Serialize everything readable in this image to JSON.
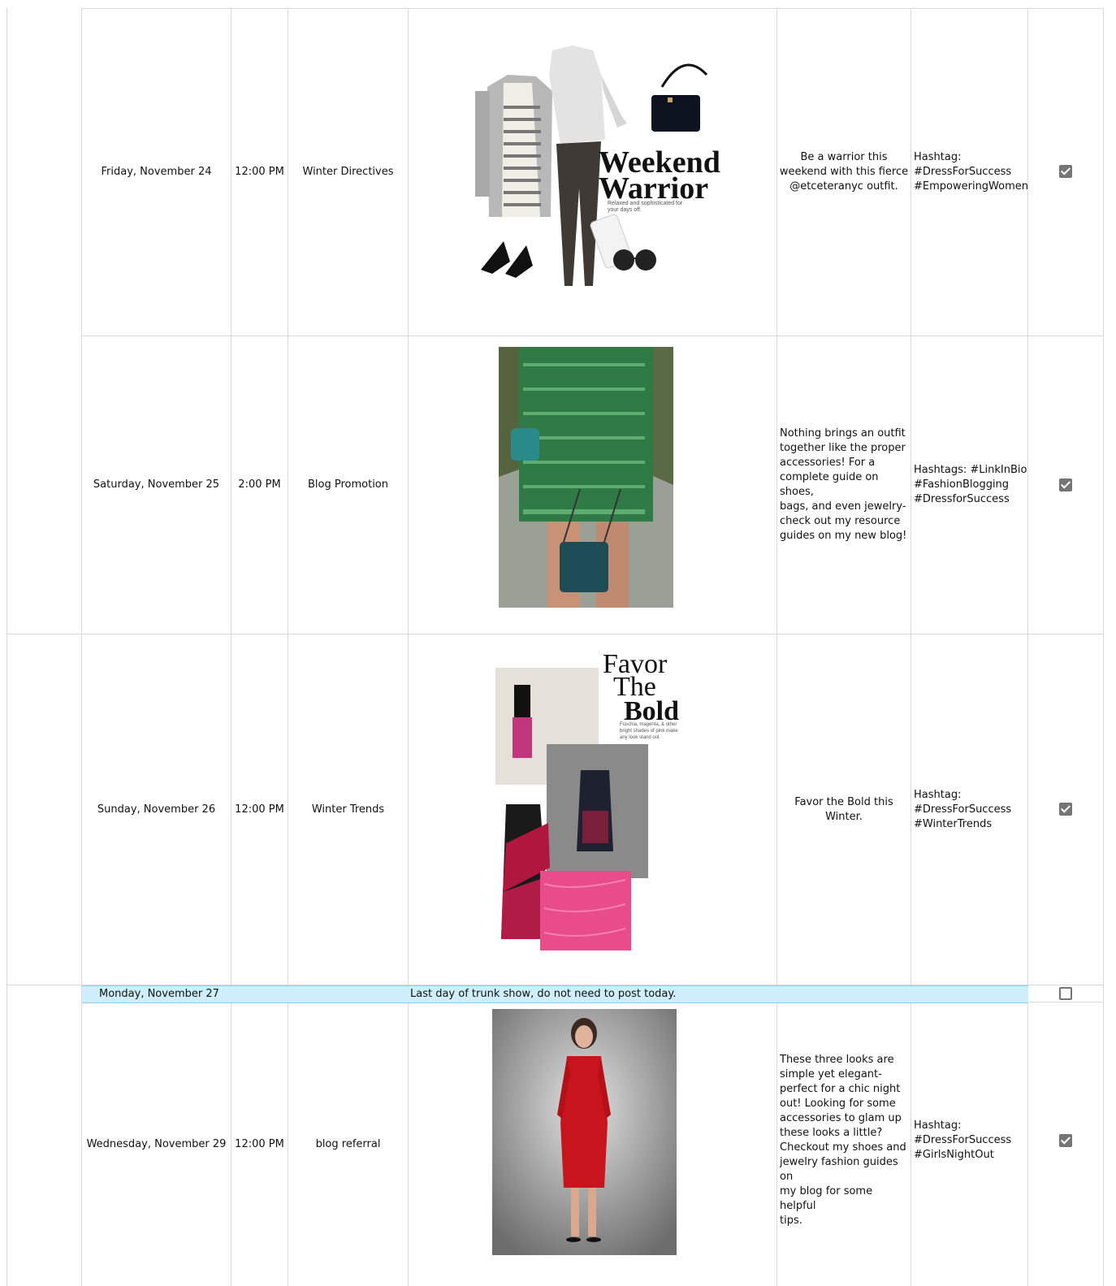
{
  "rows": [
    {
      "date": "Friday, November 24",
      "time": "12:00 PM",
      "topic": "Winter Directives",
      "image": "weekend-warrior-collage",
      "image_title": "Weekend\nWarrior",
      "image_subtitle": "Relaxed and sophisticated for\nyour days off.",
      "caption": "Be a warrior this\nweekend with this fierce\n@etceteranyc outfit.",
      "hashtags": "Hashtag:\n#DressForSuccess\n#EmpoweringWomen",
      "done": true
    },
    {
      "date": "Saturday, November 25",
      "time": "2:00 PM",
      "topic": "Blog Promotion",
      "image": "green-tweed-skirt-photo",
      "caption": "Nothing brings an outfit\ntogether like the proper\naccessories! For a\ncomplete guide on shoes,\nbags, and even jewelry-\ncheck out my resource\nguides on my new blog!",
      "hashtags": "Hashtags: #LinkInBio\n#FashionBlogging\n#DressforSuccess",
      "done": true
    },
    {
      "date": "Sunday, November 26",
      "time": "12:00 PM",
      "topic": "Winter Trends",
      "image": "favor-the-bold-collage",
      "image_title": "Favor\nThe\nBold",
      "image_subtitle": "Fuschia, magenta, & other\nbright shades of pink make\nany look stand out",
      "caption": "Favor the Bold this Winter.",
      "hashtags": "Hashtag:\n#DressForSuccess\n#WinterTrends",
      "done": true
    },
    {
      "date": "Monday, November 27",
      "note": "Last day of trunk show, do not need to post today.",
      "done": false
    },
    {
      "date": "Wednesday, November 29",
      "time": "12:00 PM",
      "topic": "blog referral",
      "image": "red-dress-photo",
      "caption": "These three looks are\nsimple yet elegant-\nperfect for a chic night\nout! Looking for some\naccessories to glam up\nthese looks a little?\nCheckout my shoes and\njewelry fashion guides on\nmy blog for some helpful\ntips.",
      "hashtags": "Hashtag:\n#DressForSuccess\n#GirlsNightOut",
      "done": true
    }
  ],
  "colors": {
    "grid": "#d9d9d9",
    "banner": "#cdeefa",
    "checkbox": "#757575"
  }
}
